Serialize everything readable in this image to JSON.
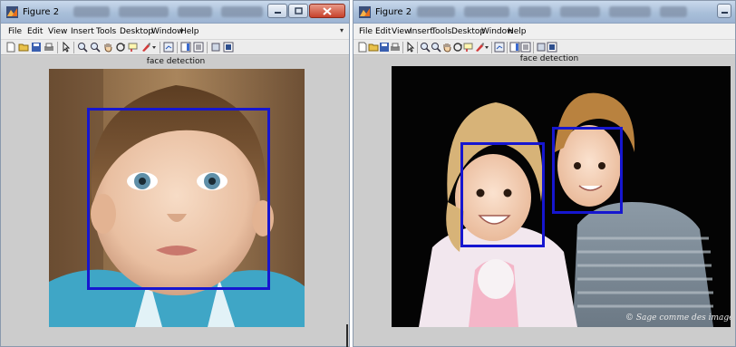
{
  "left_window": {
    "title": "Figure 2",
    "menu": [
      "File",
      "Edit",
      "View",
      "Insert",
      "Tools",
      "Desktop",
      "Window",
      "Help"
    ],
    "plot_title": "face detection",
    "detections": 1
  },
  "right_window": {
    "title": "Figure 2",
    "menu": [
      "File",
      "Edit",
      "View",
      "Insert",
      "Tools",
      "Desktop",
      "Window",
      "Help"
    ],
    "plot_title": "face detection",
    "detections": 2,
    "watermark": "© Sage comme des images"
  },
  "colors": {
    "detection_box": "#1616d0",
    "figure_background": "#cccccc",
    "title_bar": "#a9bfd9"
  },
  "icons": [
    "new-figure-icon",
    "open-file-icon",
    "save-icon",
    "print-icon",
    "pointer-icon",
    "zoom-in-icon",
    "zoom-out-icon",
    "pan-icon",
    "rotate-3d-icon",
    "data-cursor-icon",
    "brush-icon",
    "link-plot-icon",
    "colorbar-icon",
    "legend-icon",
    "hide-plot-tools-icon",
    "show-plot-tools-icon"
  ]
}
